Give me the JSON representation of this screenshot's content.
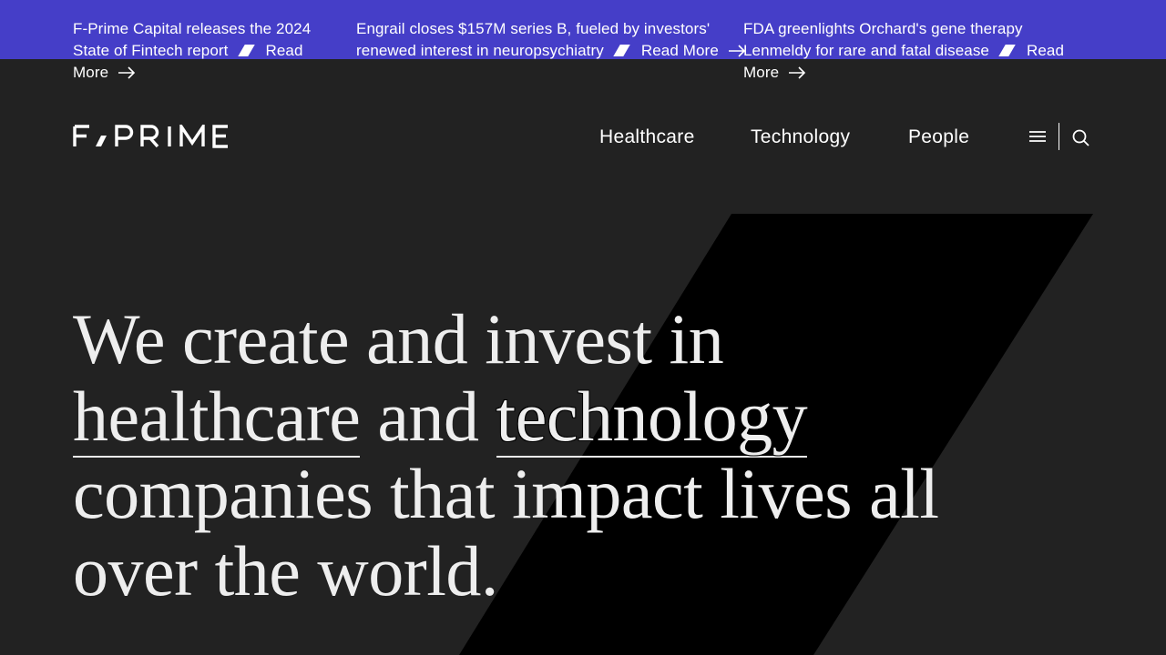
{
  "announcements": [
    {
      "text": "F-Prime Capital releases the 2024 State of Fintech report",
      "link_label": "Read More"
    },
    {
      "text": "Engrail closes $157M series B, fueled by investors' renewed interest in neuropsychiatry",
      "link_label": "Read More"
    },
    {
      "text": "FDA greenlights Orchard's gene therapy Lenmeldy for rare and fatal disease",
      "link_label": "Read More"
    }
  ],
  "header": {
    "logo_text": "F/PRIME",
    "nav": [
      {
        "label": "Healthcare"
      },
      {
        "label": "Technology"
      },
      {
        "label": "People"
      }
    ],
    "menu_icon": "hamburger-menu-icon",
    "search_icon": "search-icon"
  },
  "hero": {
    "line_1": "We create and invest in",
    "link_1": "healthcare",
    "connector": "and",
    "link_2": "technology",
    "line_3": "companies that impact lives all over the world."
  },
  "colors": {
    "announcement_bg": "#453ec8",
    "page_bg": "#222222",
    "shape": "#000000",
    "text": "#eeeeee"
  }
}
